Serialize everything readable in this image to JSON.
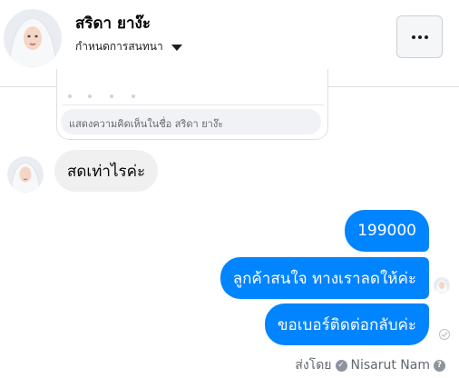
{
  "header": {
    "contact_name": "สริดา ยาง๊ะ",
    "settings_label": "กำหนดการสนทนา"
  },
  "shared_post": {
    "comment_placeholder": "แสดงความคิดเห็นในชื่อ สริดา ยาง๊ะ"
  },
  "messages": [
    {
      "direction": "incoming",
      "text": "สดเท่าไรค่ะ"
    },
    {
      "direction": "outgoing",
      "text": "199000"
    },
    {
      "direction": "outgoing",
      "text": "ลูกค้าสนใจ ทางเราลดให้ค่ะ"
    },
    {
      "direction": "outgoing",
      "text": "ขอเบอร์ติดต่อกลับค่ะ"
    }
  ],
  "footer": {
    "sent_by_label": "ส่งโดย",
    "sender_name": "Nisarut Nam"
  },
  "colors": {
    "outgoing_bubble": "#0084ff",
    "incoming_bubble": "#f0f0f0"
  }
}
